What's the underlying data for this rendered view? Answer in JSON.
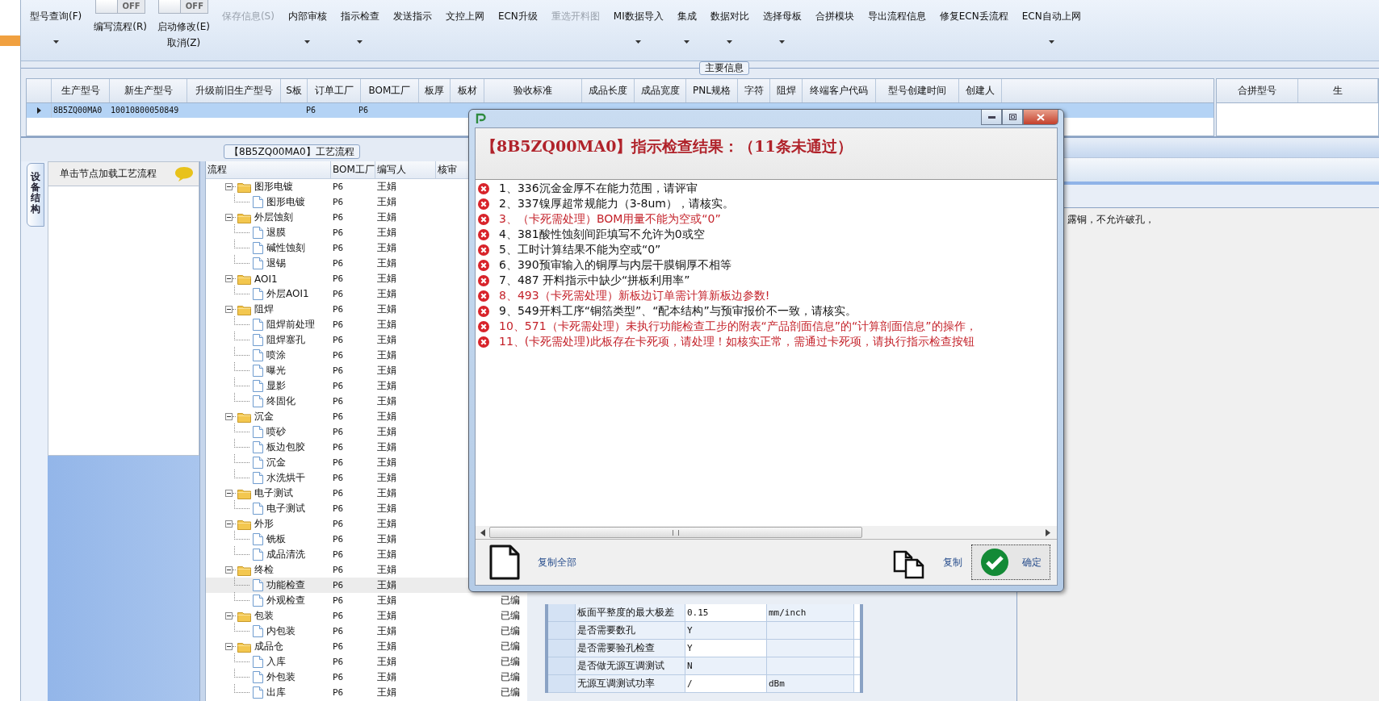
{
  "toolbar": {
    "items": [
      {
        "kind": "button",
        "label": "型号查询(F)",
        "dropdown": true,
        "disabled": false
      },
      {
        "kind": "toggle",
        "toggle_text": "OFF",
        "on": false,
        "label": "编写流程(R)"
      },
      {
        "kind": "toggle",
        "toggle_text": "OFF",
        "on": false,
        "label": "启动修改(E)",
        "sublabel": "取消(Z)"
      },
      {
        "kind": "button",
        "label": "保存信息(S)",
        "dropdown": false,
        "disabled": true
      },
      {
        "kind": "button",
        "label": "内部审核",
        "dropdown": true,
        "disabled": false
      },
      {
        "kind": "button",
        "label": "指示检查",
        "dropdown": true,
        "disabled": false
      },
      {
        "kind": "button",
        "label": "发送指示",
        "dropdown": false,
        "disabled": false
      },
      {
        "kind": "button",
        "label": "文控上网",
        "dropdown": false,
        "disabled": false
      },
      {
        "kind": "button",
        "label": "ECN升级",
        "dropdown": false,
        "disabled": false
      },
      {
        "kind": "button",
        "label": "重选开料图",
        "dropdown": false,
        "disabled": true
      },
      {
        "kind": "button",
        "label": "MI数据导入",
        "dropdown": true,
        "disabled": false
      },
      {
        "kind": "button",
        "label": "集成",
        "dropdown": true,
        "disabled": false
      },
      {
        "kind": "button",
        "label": "数据对比",
        "dropdown": true,
        "disabled": false
      },
      {
        "kind": "button",
        "label": "选择母板",
        "dropdown": true,
        "disabled": false
      },
      {
        "kind": "button",
        "label": "合拼模块",
        "dropdown": false,
        "disabled": false
      },
      {
        "kind": "button",
        "label": "导出流程信息",
        "dropdown": false,
        "disabled": false
      },
      {
        "kind": "button",
        "label": "修复ECN丢流程",
        "dropdown": false,
        "disabled": false
      },
      {
        "kind": "button",
        "label": "ECN自动上网",
        "dropdown": true,
        "disabled": false
      }
    ]
  },
  "main_info": {
    "title": "主要信息",
    "columns": [
      "生产型号",
      "新生产型号",
      "升级前旧生产型号",
      "S板",
      "订单工厂",
      "BOM工厂",
      "板厚",
      "板材",
      "验收标准",
      "成品长度",
      "成品宽度",
      "PNL规格",
      "字符",
      "阻焊",
      "终端客户代码",
      "型号创建时间",
      "创建人"
    ],
    "rows": [
      {
        "selected": true,
        "production_model": "8B5ZQ00MA0",
        "new_production_model": "10010800050849",
        "order_factory": "P6",
        "bom_factory": "P6"
      }
    ]
  },
  "merge_table": {
    "columns": [
      "合拼型号",
      "生"
    ]
  },
  "process_tree": {
    "title": "【8B5ZQ00MA0】工艺流程",
    "columns": [
      "流程",
      "BOM工厂",
      "编写人",
      "核审"
    ],
    "nodes": [
      {
        "name": "图形电镀",
        "factory": "P6",
        "writer": "王娟",
        "expanded": true,
        "selected": false,
        "children": [
          {
            "name": "图形电镀",
            "factory": "P6",
            "writer": "王娟",
            "selected": false
          }
        ]
      },
      {
        "name": "外层蚀刻",
        "factory": "P6",
        "writer": "王娟",
        "expanded": true,
        "selected": false,
        "children": [
          {
            "name": "退膜",
            "factory": "P6",
            "writer": "王娟",
            "selected": false
          },
          {
            "name": "碱性蚀刻",
            "factory": "P6",
            "writer": "王娟",
            "selected": false
          },
          {
            "name": "退锡",
            "factory": "P6",
            "writer": "王娟",
            "selected": false
          }
        ]
      },
      {
        "name": "AOI1",
        "factory": "P6",
        "writer": "王娟",
        "expanded": true,
        "selected": false,
        "children": [
          {
            "name": "外层AOI1",
            "factory": "P6",
            "writer": "王娟",
            "selected": false
          }
        ]
      },
      {
        "name": "阻焊",
        "factory": "P6",
        "writer": "王娟",
        "expanded": true,
        "selected": false,
        "children": [
          {
            "name": "阻焊前处理",
            "factory": "P6",
            "writer": "王娟",
            "selected": false
          },
          {
            "name": "阻焊塞孔",
            "factory": "P6",
            "writer": "王娟",
            "selected": false
          },
          {
            "name": "喷涂",
            "factory": "P6",
            "writer": "王娟",
            "selected": false
          },
          {
            "name": "曝光",
            "factory": "P6",
            "writer": "王娟",
            "selected": false
          },
          {
            "name": "显影",
            "factory": "P6",
            "writer": "王娟",
            "selected": false
          },
          {
            "name": "终固化",
            "factory": "P6",
            "writer": "王娟",
            "selected": false
          }
        ]
      },
      {
        "name": "沉金",
        "factory": "P6",
        "writer": "王娟",
        "expanded": true,
        "selected": false,
        "children": [
          {
            "name": "喷砂",
            "factory": "P6",
            "writer": "王娟",
            "selected": false
          },
          {
            "name": "板边包胶",
            "factory": "P6",
            "writer": "王娟",
            "selected": false
          },
          {
            "name": "沉金",
            "factory": "P6",
            "writer": "王娟",
            "selected": false
          },
          {
            "name": "水洗烘干",
            "factory": "P6",
            "writer": "王娟",
            "selected": false
          }
        ]
      },
      {
        "name": "电子测试",
        "factory": "P6",
        "writer": "王娟",
        "expanded": true,
        "selected": false,
        "children": [
          {
            "name": "电子测试",
            "factory": "P6",
            "writer": "王娟",
            "selected": false
          }
        ]
      },
      {
        "name": "外形",
        "factory": "P6",
        "writer": "王娟",
        "expanded": true,
        "selected": false,
        "children": [
          {
            "name": "铣板",
            "factory": "P6",
            "writer": "王娟",
            "selected": false
          },
          {
            "name": "成品清洗",
            "factory": "P6",
            "writer": "王娟",
            "selected": false
          }
        ]
      },
      {
        "name": "终检",
        "factory": "P6",
        "writer": "王娟",
        "expanded": true,
        "selected": false,
        "children": [
          {
            "name": "功能检查",
            "factory": "P6",
            "writer": "王娟",
            "selected": true
          },
          {
            "name": "外观检查",
            "factory": "P6",
            "writer": "王娟",
            "status": "已编",
            "selected": false
          }
        ]
      },
      {
        "name": "包装",
        "factory": "P6",
        "writer": "王娟",
        "status": "已编",
        "expanded": true,
        "selected": false,
        "children": [
          {
            "name": "内包装",
            "factory": "P6",
            "writer": "王娟",
            "status": "已编",
            "selected": false
          }
        ]
      },
      {
        "name": "成品仓",
        "factory": "P6",
        "writer": "王娟",
        "status": "已编",
        "expanded": true,
        "selected": false,
        "children": [
          {
            "name": "入库",
            "factory": "P6",
            "writer": "王娟",
            "status": "已编",
            "selected": false
          },
          {
            "name": "外包装",
            "factory": "P6",
            "writer": "王娟",
            "status": "已编",
            "selected": false
          },
          {
            "name": "出库",
            "factory": "P6",
            "writer": "王娟",
            "status": "已编",
            "selected": false
          }
        ]
      }
    ]
  },
  "side_tab": {
    "label": "设备结构"
  },
  "left_panel": {
    "header": "单击节点加载工艺流程"
  },
  "remark_text": "露铜，不允许破孔，",
  "properties": [
    {
      "name": "板面平整度的最大极差",
      "value": "0.15",
      "unit": "mm/inch"
    },
    {
      "name": "是否需要数孔",
      "value": "Y"
    },
    {
      "name": "是否需要验孔检查",
      "value": "Y"
    },
    {
      "name": "是否做无源互调测试",
      "value": "N"
    },
    {
      "name": "无源互调测试功率",
      "value": "/",
      "unit": "dBm"
    }
  ],
  "dialog": {
    "heading": "【8B5ZQ00MA0】指示检查结果：（11条未通过）",
    "messages": [
      {
        "text": "1、336沉金金厚不在能力范围，请评审",
        "blocking": false
      },
      {
        "text": "2、337镍厚超常规能力（3-8um），请核实。",
        "blocking": false
      },
      {
        "text": "3、（卡死需处理）BOM用量不能为空或“0”",
        "blocking": true
      },
      {
        "text": "4、381酸性蚀刻间距填写不允许为0或空",
        "blocking": false
      },
      {
        "text": "5、工时计算结果不能为空或“0”",
        "blocking": false
      },
      {
        "text": "6、390预审输入的铜厚与内层干膜铜厚不相等",
        "blocking": false
      },
      {
        "text": "7、487 开料指示中缺少“拼板利用率”",
        "blocking": false
      },
      {
        "text": "8、493（卡死需处理）新板边订单需计算新板边参数!",
        "blocking": true
      },
      {
        "text": "9、549开料工序“铜箔类型”、“配本结构”与预审报价不一致，请核实。",
        "blocking": false
      },
      {
        "text": "10、571（卡死需处理）未执行功能检查工步的附表“产品剖面信息”的“计算剖面信息”的操作，",
        "blocking": true
      },
      {
        "text": "11、(卡死需处理)此板存在卡死项，请处理！如核实正常，需通过卡死项，请执行指示检查按钮",
        "blocking": true
      }
    ],
    "buttons": [
      {
        "kind": "copy_all",
        "label": "复制全部",
        "focused": false
      },
      {
        "kind": "copy",
        "label": "复制",
        "focused": false
      },
      {
        "kind": "ok",
        "label": "确定",
        "focused": true
      }
    ]
  }
}
